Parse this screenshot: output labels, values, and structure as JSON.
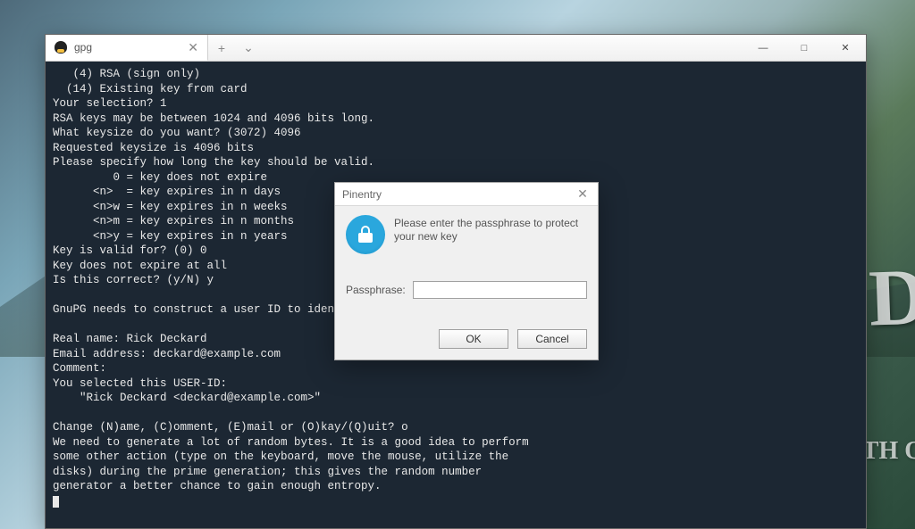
{
  "window": {
    "tab_title": "gpg",
    "new_tab_glyph": "+",
    "dropdown_glyph": "⌄",
    "min_glyph": "—",
    "max_glyph": "□",
    "close_glyph": "✕",
    "tab_close_glyph": "✕"
  },
  "terminal": {
    "lines": [
      "   (4) RSA (sign only)",
      "  (14) Existing key from card",
      "Your selection? 1",
      "RSA keys may be between 1024 and 4096 bits long.",
      "What keysize do you want? (3072) 4096",
      "Requested keysize is 4096 bits",
      "Please specify how long the key should be valid.",
      "         0 = key does not expire",
      "      <n>  = key expires in n days",
      "      <n>w = key expires in n weeks",
      "      <n>m = key expires in n months",
      "      <n>y = key expires in n years",
      "Key is valid for? (0) 0",
      "Key does not expire at all",
      "Is this correct? (y/N) y",
      "",
      "GnuPG needs to construct a user ID to identify your key.",
      "",
      "Real name: Rick Deckard",
      "Email address: deckard@example.com",
      "Comment:",
      "You selected this USER-ID:",
      "    \"Rick Deckard <deckard@example.com>\"",
      "",
      "Change (N)ame, (C)omment, (E)mail or (O)kay/(Q)uit? o",
      "We need to generate a lot of random bytes. It is a good idea to perform",
      "some other action (type on the keyboard, move the mouse, utilize the",
      "disks) during the prime generation; this gives the random number",
      "generator a better chance to gain enough entropy."
    ]
  },
  "dialog": {
    "title": "Pinentry",
    "close_glyph": "✕",
    "message": "Please enter the passphrase to protect your new key",
    "field_label": "Passphrase:",
    "field_value": "",
    "ok_label": "OK",
    "cancel_label": "Cancel"
  },
  "background": {
    "big_letters": "GEN\nD",
    "sub": "TH  O"
  }
}
